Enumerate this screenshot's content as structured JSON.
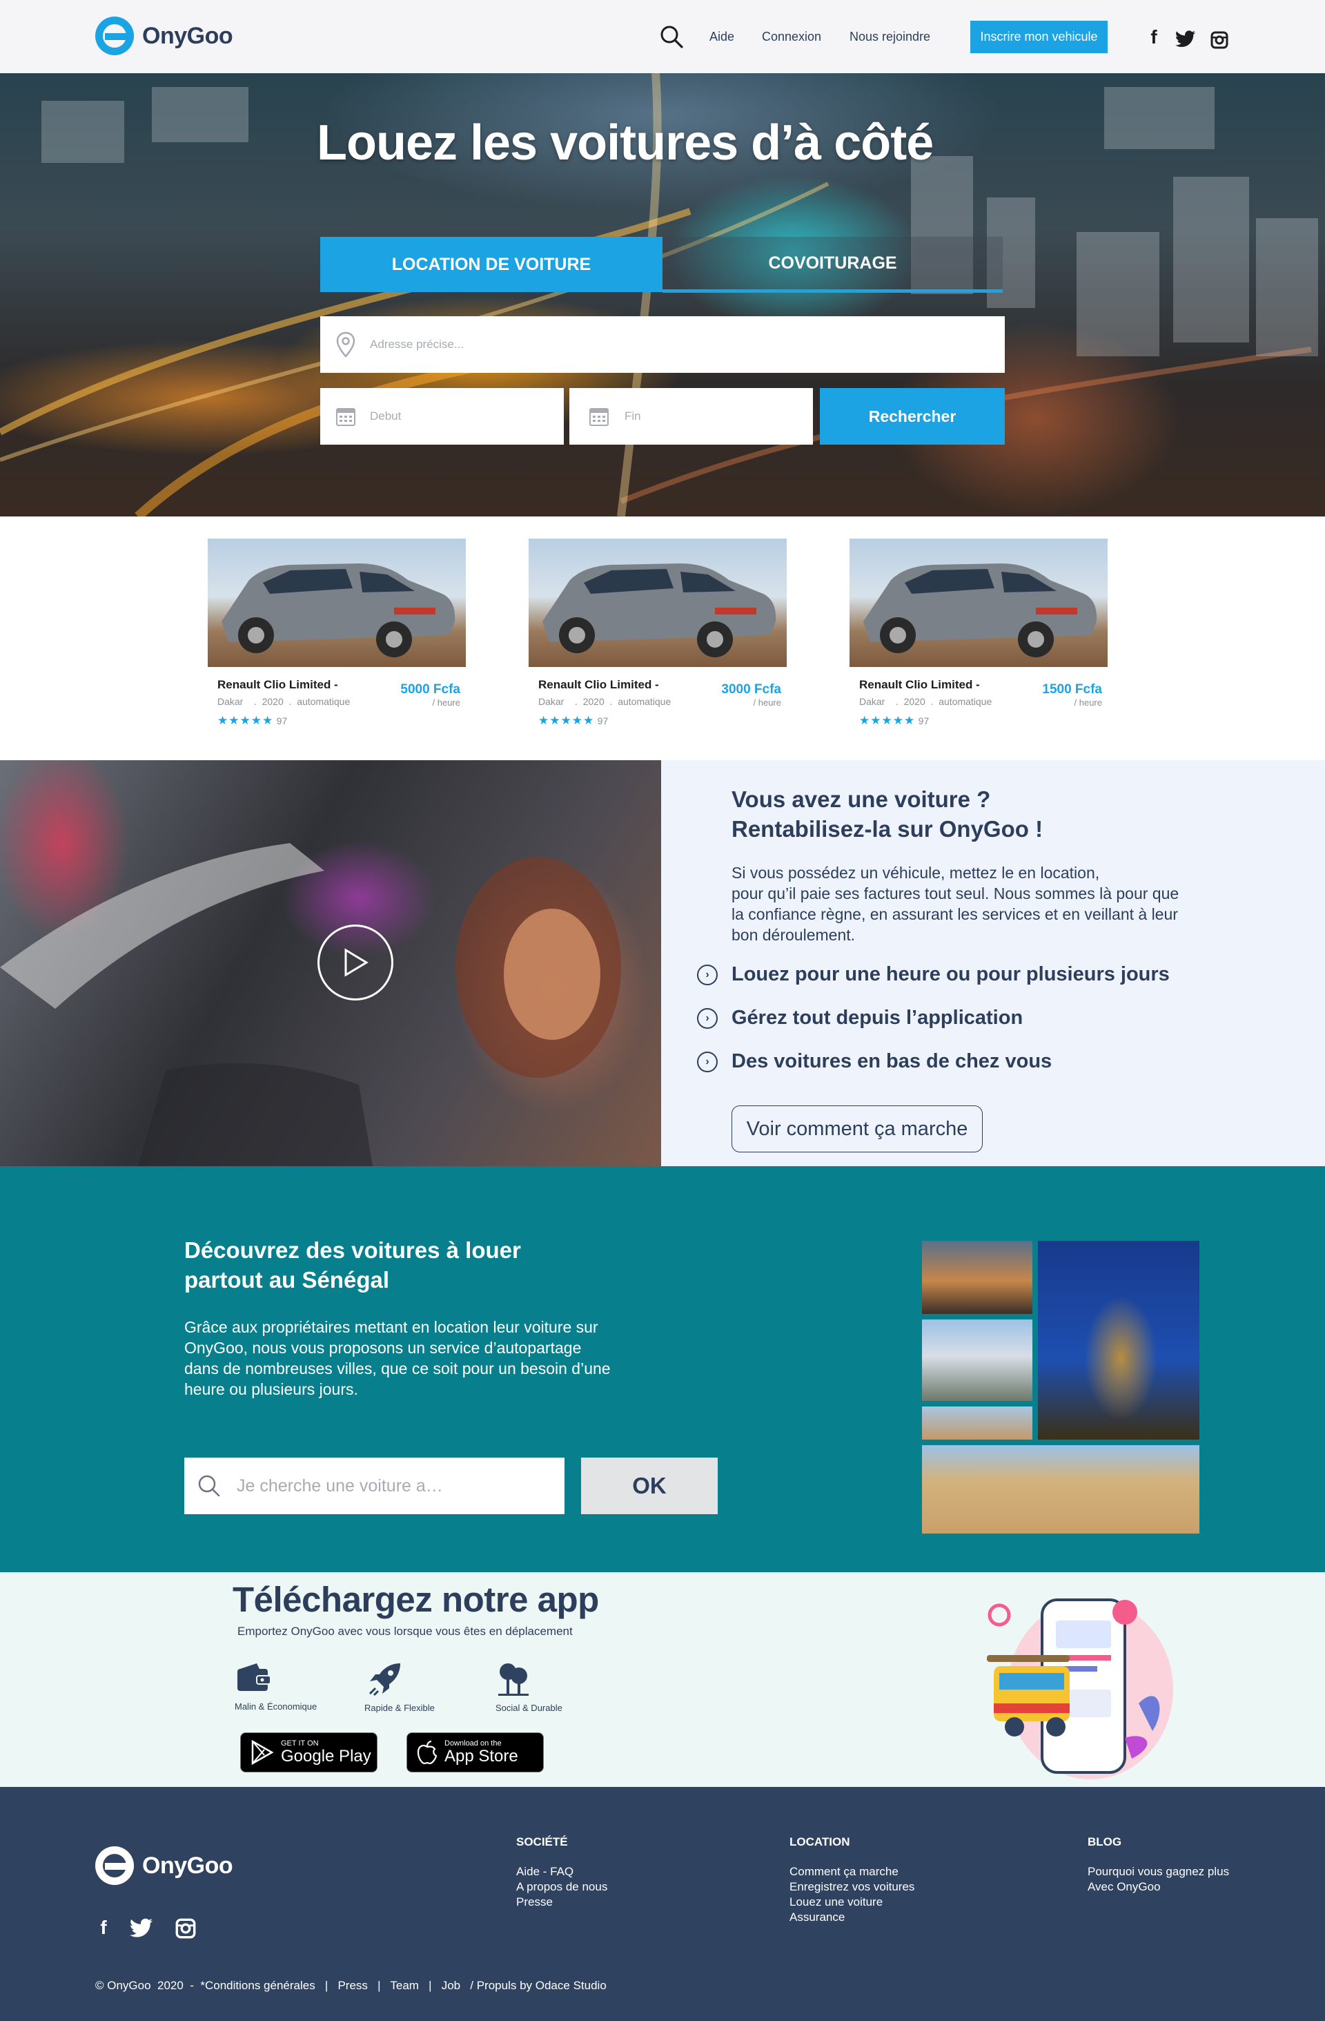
{
  "brand": {
    "name": "OnyGoo",
    "accent": "#1ba3e3",
    "dark": "#2c3e5c",
    "teal": "#087f8c",
    "footer_bg": "#2f4260"
  },
  "header": {
    "links": [
      "Aide",
      "Connexion",
      "Nous rejoindre"
    ],
    "cta": "Inscrire mon vehicule",
    "social": [
      "facebook-icon",
      "twitter-icon",
      "instagram-icon"
    ]
  },
  "hero": {
    "title": "Louez les voitures d’à côté",
    "tabs": [
      "LOCATION DE VOITURE",
      "COVOITURAGE"
    ],
    "address_placeholder": "Adresse précise...",
    "start_placeholder": "Debut",
    "end_placeholder": "Fin",
    "search_label": "Rechercher"
  },
  "cars": [
    {
      "name": "Renault Clio Limited -",
      "city": "Dakar",
      "year": "2020",
      "gearbox": "automatique",
      "price": "5000 Fcfa",
      "unit": "/ heure",
      "stars": "★★★★★",
      "reviews": "97"
    },
    {
      "name": "Renault Clio Limited -",
      "city": "Dakar",
      "year": "2020",
      "gearbox": "automatique",
      "price": "3000 Fcfa",
      "unit": "/ heure",
      "stars": "★★★★★",
      "reviews": "97"
    },
    {
      "name": "Renault Clio Limited -",
      "city": "Dakar",
      "year": "2020",
      "gearbox": "automatique",
      "price": "1500 Fcfa",
      "unit": "/ heure",
      "stars": "★★★★★",
      "reviews": "97"
    }
  ],
  "owner": {
    "title_line1": "Vous avez une voiture ?",
    "title_line2": "Rentabilisez-la sur OnyGoo !",
    "body": [
      "Si vous possédez un véhicule, mettez le en location,",
      "pour qu’il paie ses factures tout seul. Nous sommes là pour que",
      "la confiance règne, en assurant les services et en veillant à leur",
      "bon déroulement."
    ],
    "features": [
      "Louez pour une heure ou pour plusieurs jours",
      "Gérez tout depuis l’application",
      "Des voitures en bas de chez vous"
    ],
    "cta": "Voir comment ça marche"
  },
  "discover": {
    "title_line1": "Découvrez des voitures à louer",
    "title_line2": "partout au Sénégal",
    "body": [
      "Grâce aux propriétaires mettant en location leur voiture sur",
      "OnyGoo, nous vous proposons un service d’autopartage",
      "dans de nombreuses villes, que ce soit pour un besoin d’une",
      "heure ou plusieurs jours."
    ],
    "search_placeholder": "Je cherche une voiture a…",
    "ok_label": "OK"
  },
  "app": {
    "title": "Téléchargez notre app",
    "subtitle": "Emportez OnyGoo avec vous lorsque vous êtes en déplacement",
    "features": [
      "Malin & Économique",
      "Rapide & Flexible",
      "Social & Durable"
    ],
    "google": {
      "small": "GET IT ON",
      "big": "Google Play"
    },
    "apple": {
      "small": "Download on the",
      "big": "App Store"
    }
  },
  "footer": {
    "columns": [
      {
        "title": "SOCIÉTÉ",
        "links": [
          "Aide - FAQ",
          "A propos de nous",
          "Presse"
        ]
      },
      {
        "title": "LOCATION",
        "links": [
          "Comment ça marche",
          "Enregistrez vos voitures",
          "Louez une voiture",
          "Assurance"
        ]
      },
      {
        "title": "BLOG",
        "links": [
          "Pourquoi vous gagnez plus",
          "Avec OnyGoo"
        ]
      }
    ],
    "bottom": "© OnyGoo  2020  -  *Conditions générales   |   Press   |   Team   |   Job   / Propuls by Odace Studio"
  }
}
